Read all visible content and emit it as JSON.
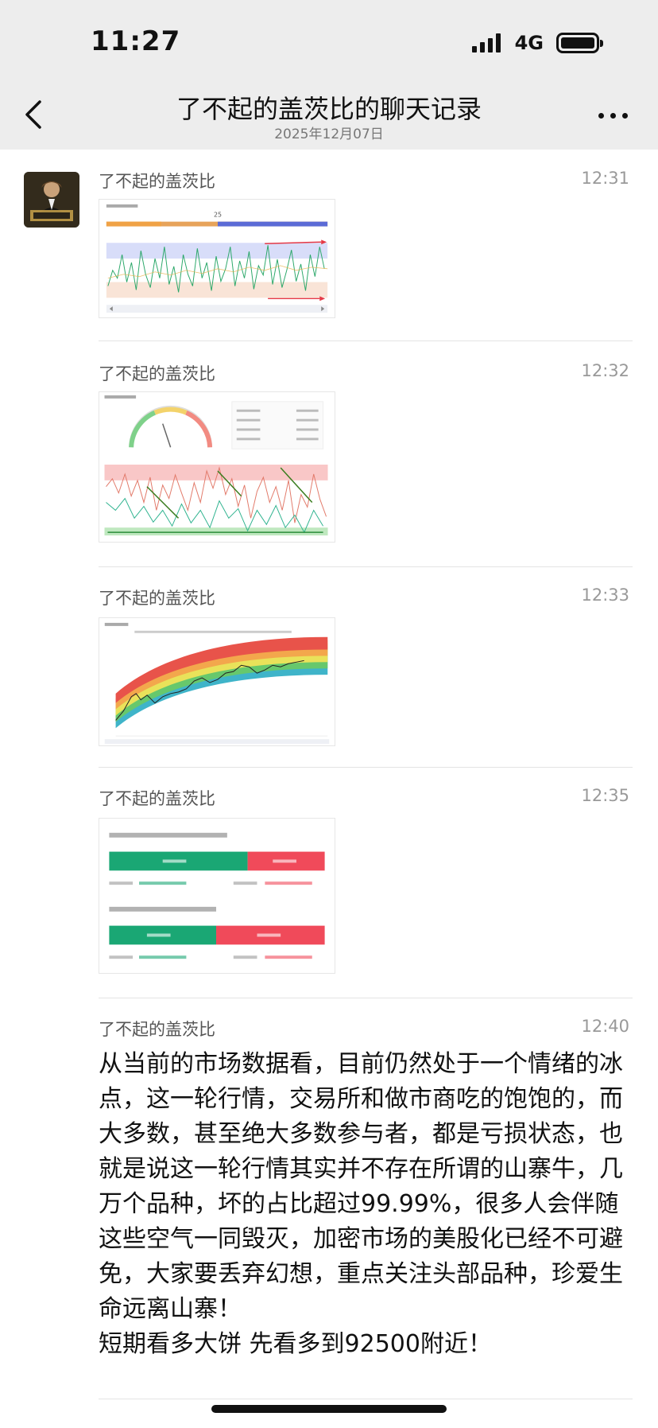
{
  "status_bar": {
    "time": "11:27",
    "network": "4G"
  },
  "nav": {
    "title": "了不起的盖茨比的聊天记录",
    "date": "2025年12月07日"
  },
  "messages": [
    {
      "sender": "了不起的盖茨比",
      "time": "12:31",
      "kind": "image"
    },
    {
      "sender": "了不起的盖茨比",
      "time": "12:32",
      "kind": "image"
    },
    {
      "sender": "了不起的盖茨比",
      "time": "12:33",
      "kind": "image"
    },
    {
      "sender": "了不起的盖茨比",
      "time": "12:35",
      "kind": "image"
    },
    {
      "sender": "了不起的盖茨比",
      "time": "12:40",
      "kind": "text",
      "text": [
        "从当前的市场数据看，目前仍然处于一个情绪的冰点，这一轮行情，交易所和做市商吃的饱饱的，而大多数，甚至绝大多数参与者，都是亏损状态，也就是说这一轮行情其实并不存在所谓的山寨牛，几万个品种，坏的占比超过99.99%，很多人会伴随这些空气一同毁灭，加密市场的美股化已经不可避免，大家要丢弃幻想，重点关注头部品种，珍爱生命远离山寨！",
        "短期看多大饼 先看多到92500附近！"
      ]
    }
  ],
  "image1": {
    "gauge_value": "25"
  },
  "colors": {
    "nav_bg": "#ededed",
    "green": "#1aa774",
    "red": "#f04a5a"
  }
}
